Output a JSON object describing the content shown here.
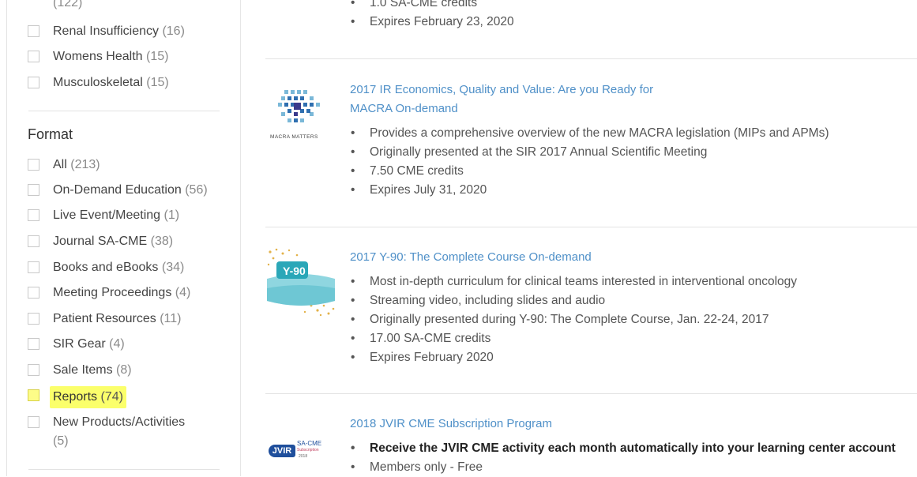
{
  "sidebar": {
    "top_count": "(122)",
    "topics": [
      {
        "label": "Renal Insufficiency",
        "count": "(16)"
      },
      {
        "label": "Womens Health",
        "count": "(15)"
      },
      {
        "label": "Musculoskeletal",
        "count": "(15)"
      }
    ],
    "format_title": "Format",
    "formats": [
      {
        "label": "All",
        "count": "(213)"
      },
      {
        "label": "On-Demand Education",
        "count": "(56)"
      },
      {
        "label": "Live Event/Meeting",
        "count": "(1)"
      },
      {
        "label": "Journal SA-CME",
        "count": "(38)"
      },
      {
        "label": "Books and eBooks",
        "count": "(34)"
      },
      {
        "label": "Meeting Proceedings",
        "count": "(4)"
      },
      {
        "label": "Patient Resources",
        "count": "(11)"
      },
      {
        "label": "SIR Gear",
        "count": "(4)"
      },
      {
        "label": "Sale Items",
        "count": "(8)"
      },
      {
        "label": "Reports",
        "count": "(74)"
      },
      {
        "label": "New Products/Activities",
        "count": "(5)"
      }
    ]
  },
  "products": [
    {
      "bullets": [
        "1.0 SA-CME credits",
        "Expires February 23, 2020"
      ]
    },
    {
      "title": "2017 IR Economics, Quality and Value: Are you Ready for MACRA On-demand",
      "logo_text": "MACRA MATTERS",
      "bullets": [
        "Provides a comprehensive overview of the new MACRA legislation (MIPs and APMs)",
        "Originally presented at the SIR 2017 Annual Scientific Meeting",
        "7.50 CME credits",
        "Expires July 31, 2020"
      ]
    },
    {
      "title": "2017 Y-90: The Complete Course On-demand",
      "logo_text": "Y-90",
      "bullets": [
        "Most in-depth curriculum for clinical teams interested in interventional oncology",
        "Streaming video, including slides and audio",
        "Originally presented during Y-90: The Complete Course, Jan. 22-24, 2017",
        "17.00 SA-CME credits",
        "Expires February 2020"
      ]
    },
    {
      "title": "2018 JVIR CME Subscription Program",
      "logo_text": "JVIR",
      "logo_sub": "SA-CME",
      "logo_sub2": "Subscription",
      "logo_year": "2018",
      "bullets": [
        "Receive the JVIR CME activity each month automatically into your learning center account",
        "Members only - Free"
      ]
    }
  ],
  "colors": {
    "link": "#4f90c8",
    "highlight": "#fbff6b"
  }
}
